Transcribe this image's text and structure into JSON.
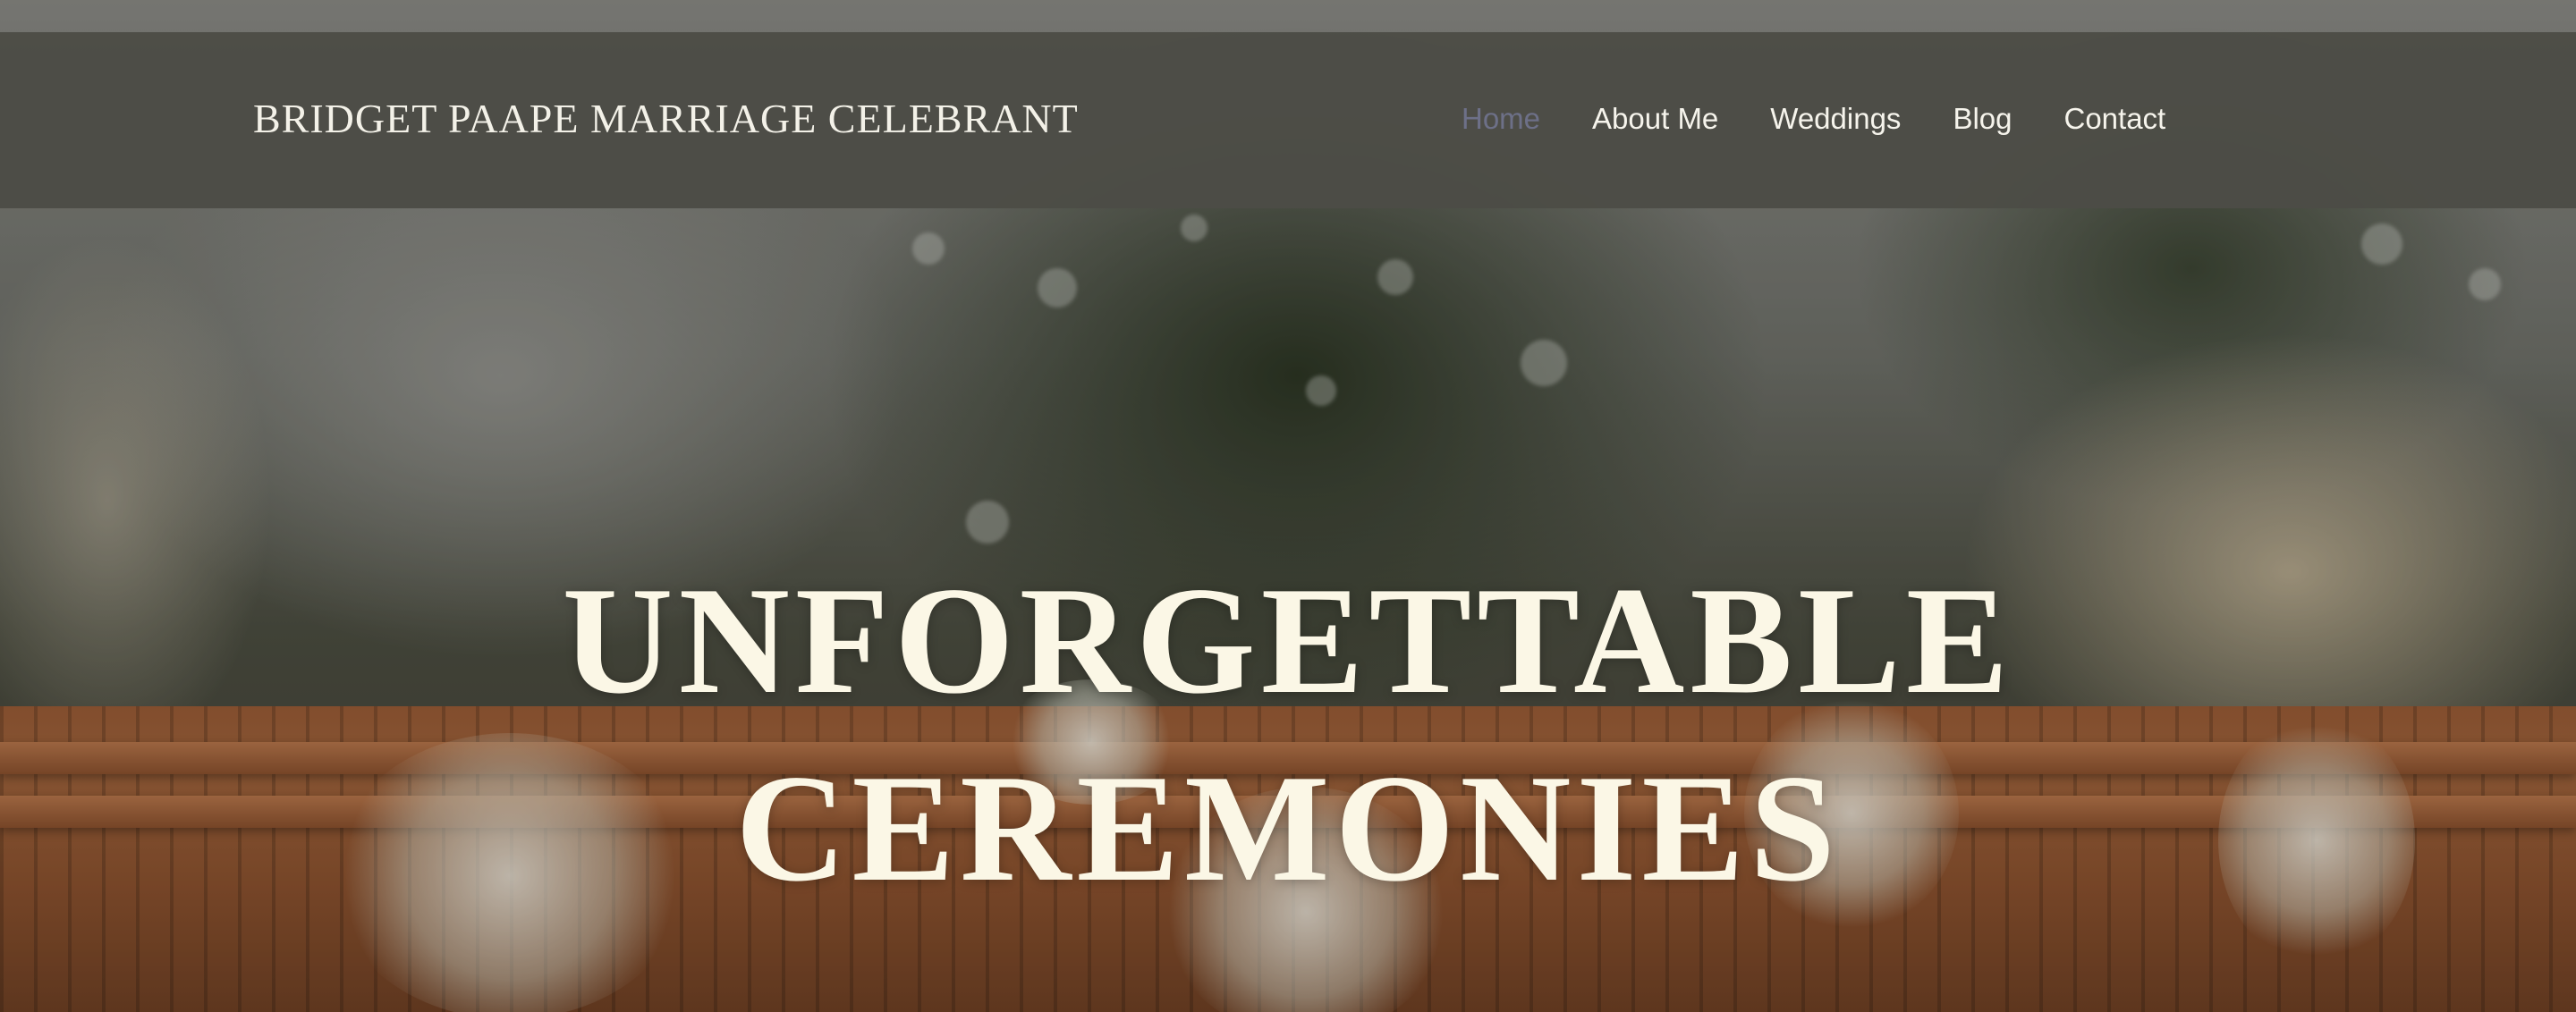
{
  "site": {
    "title": "BRIDGET PAAPE MARRIAGE CELEBRANT"
  },
  "nav": {
    "items": [
      {
        "label": "Home",
        "active": true
      },
      {
        "label": "About Me",
        "active": false
      },
      {
        "label": "Weddings",
        "active": false
      },
      {
        "label": "Blog",
        "active": false
      },
      {
        "label": "Contact",
        "active": false
      }
    ]
  },
  "hero": {
    "headline_line1": "UNFORGETTABLE",
    "headline_line2": "CEREMONIES",
    "background_image": "blurred outdoor wedding ceremony with wooden benches and white flower bouquets"
  },
  "colors": {
    "navbar_bg": "#4c4c46",
    "nav_text": "#f6f4ec",
    "nav_active": "#6d7088",
    "headline": "#fbf7e6"
  }
}
